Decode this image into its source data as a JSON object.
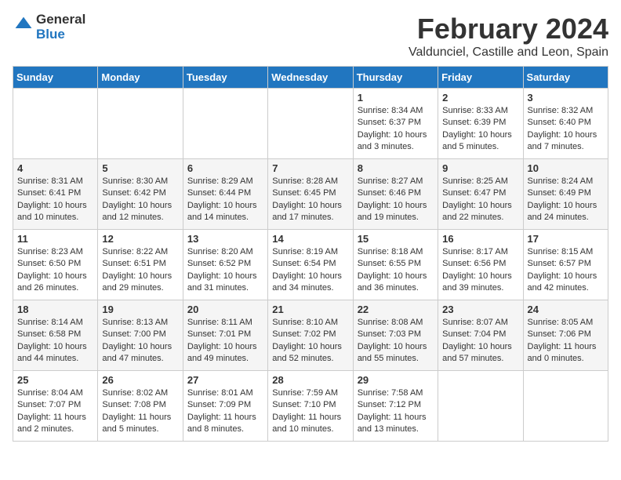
{
  "header": {
    "logo_line1": "General",
    "logo_line2": "Blue",
    "month": "February 2024",
    "location": "Valdunciel, Castille and Leon, Spain"
  },
  "days_of_week": [
    "Sunday",
    "Monday",
    "Tuesday",
    "Wednesday",
    "Thursday",
    "Friday",
    "Saturday"
  ],
  "weeks": [
    [
      {
        "day": "",
        "text": ""
      },
      {
        "day": "",
        "text": ""
      },
      {
        "day": "",
        "text": ""
      },
      {
        "day": "",
        "text": ""
      },
      {
        "day": "1",
        "text": "Sunrise: 8:34 AM\nSunset: 6:37 PM\nDaylight: 10 hours\nand 3 minutes."
      },
      {
        "day": "2",
        "text": "Sunrise: 8:33 AM\nSunset: 6:39 PM\nDaylight: 10 hours\nand 5 minutes."
      },
      {
        "day": "3",
        "text": "Sunrise: 8:32 AM\nSunset: 6:40 PM\nDaylight: 10 hours\nand 7 minutes."
      }
    ],
    [
      {
        "day": "4",
        "text": "Sunrise: 8:31 AM\nSunset: 6:41 PM\nDaylight: 10 hours\nand 10 minutes."
      },
      {
        "day": "5",
        "text": "Sunrise: 8:30 AM\nSunset: 6:42 PM\nDaylight: 10 hours\nand 12 minutes."
      },
      {
        "day": "6",
        "text": "Sunrise: 8:29 AM\nSunset: 6:44 PM\nDaylight: 10 hours\nand 14 minutes."
      },
      {
        "day": "7",
        "text": "Sunrise: 8:28 AM\nSunset: 6:45 PM\nDaylight: 10 hours\nand 17 minutes."
      },
      {
        "day": "8",
        "text": "Sunrise: 8:27 AM\nSunset: 6:46 PM\nDaylight: 10 hours\nand 19 minutes."
      },
      {
        "day": "9",
        "text": "Sunrise: 8:25 AM\nSunset: 6:47 PM\nDaylight: 10 hours\nand 22 minutes."
      },
      {
        "day": "10",
        "text": "Sunrise: 8:24 AM\nSunset: 6:49 PM\nDaylight: 10 hours\nand 24 minutes."
      }
    ],
    [
      {
        "day": "11",
        "text": "Sunrise: 8:23 AM\nSunset: 6:50 PM\nDaylight: 10 hours\nand 26 minutes."
      },
      {
        "day": "12",
        "text": "Sunrise: 8:22 AM\nSunset: 6:51 PM\nDaylight: 10 hours\nand 29 minutes."
      },
      {
        "day": "13",
        "text": "Sunrise: 8:20 AM\nSunset: 6:52 PM\nDaylight: 10 hours\nand 31 minutes."
      },
      {
        "day": "14",
        "text": "Sunrise: 8:19 AM\nSunset: 6:54 PM\nDaylight: 10 hours\nand 34 minutes."
      },
      {
        "day": "15",
        "text": "Sunrise: 8:18 AM\nSunset: 6:55 PM\nDaylight: 10 hours\nand 36 minutes."
      },
      {
        "day": "16",
        "text": "Sunrise: 8:17 AM\nSunset: 6:56 PM\nDaylight: 10 hours\nand 39 minutes."
      },
      {
        "day": "17",
        "text": "Sunrise: 8:15 AM\nSunset: 6:57 PM\nDaylight: 10 hours\nand 42 minutes."
      }
    ],
    [
      {
        "day": "18",
        "text": "Sunrise: 8:14 AM\nSunset: 6:58 PM\nDaylight: 10 hours\nand 44 minutes."
      },
      {
        "day": "19",
        "text": "Sunrise: 8:13 AM\nSunset: 7:00 PM\nDaylight: 10 hours\nand 47 minutes."
      },
      {
        "day": "20",
        "text": "Sunrise: 8:11 AM\nSunset: 7:01 PM\nDaylight: 10 hours\nand 49 minutes."
      },
      {
        "day": "21",
        "text": "Sunrise: 8:10 AM\nSunset: 7:02 PM\nDaylight: 10 hours\nand 52 minutes."
      },
      {
        "day": "22",
        "text": "Sunrise: 8:08 AM\nSunset: 7:03 PM\nDaylight: 10 hours\nand 55 minutes."
      },
      {
        "day": "23",
        "text": "Sunrise: 8:07 AM\nSunset: 7:04 PM\nDaylight: 10 hours\nand 57 minutes."
      },
      {
        "day": "24",
        "text": "Sunrise: 8:05 AM\nSunset: 7:06 PM\nDaylight: 11 hours\nand 0 minutes."
      }
    ],
    [
      {
        "day": "25",
        "text": "Sunrise: 8:04 AM\nSunset: 7:07 PM\nDaylight: 11 hours\nand 2 minutes."
      },
      {
        "day": "26",
        "text": "Sunrise: 8:02 AM\nSunset: 7:08 PM\nDaylight: 11 hours\nand 5 minutes."
      },
      {
        "day": "27",
        "text": "Sunrise: 8:01 AM\nSunset: 7:09 PM\nDaylight: 11 hours\nand 8 minutes."
      },
      {
        "day": "28",
        "text": "Sunrise: 7:59 AM\nSunset: 7:10 PM\nDaylight: 11 hours\nand 10 minutes."
      },
      {
        "day": "29",
        "text": "Sunrise: 7:58 AM\nSunset: 7:12 PM\nDaylight: 11 hours\nand 13 minutes."
      },
      {
        "day": "",
        "text": ""
      },
      {
        "day": "",
        "text": ""
      }
    ]
  ]
}
